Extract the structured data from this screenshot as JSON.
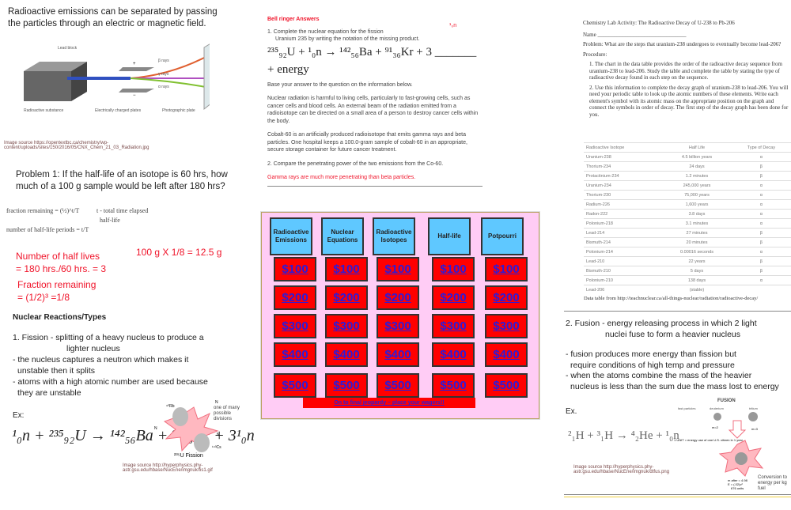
{
  "left": {
    "intro": [
      "Radioactive emissions can be separated by passing",
      "the particles through an electric or magnetic field."
    ],
    "diagram_labels": {
      "lead_block": "Lead block",
      "beta": "β rays",
      "gamma": "γ rays",
      "alpha": "α rays",
      "substance": "Radioactive substance",
      "plates": "Electrically charged plates",
      "plate": "Photographic plate",
      "plus": "+",
      "minus": "−"
    },
    "image_source_1": [
      "Image source https://opentextbc.ca/chemistry/wp-",
      "content/uploads/sites/150/2016/05/CNX_Chem_21_03_Radiation.jpg"
    ],
    "problem": [
      "Problem 1: If the half-life of an isotope is 60 hrs, how",
      "much of a 100 g sample would be left after 180 hrs?"
    ],
    "formula": {
      "fraction": "fraction remaining = (½)^t/T",
      "periods": "number of half-life periods = t/T",
      "t_def": "t - total time elapsed",
      "T_def": "half-life"
    },
    "answer": {
      "halves_1": "Number of half lives",
      "halves_2": "= 180 hrs./60 hrs. = 3",
      "frac_1": "Fraction remaining",
      "frac_2": "= (1/2)³ =1/8",
      "result": "100 g X 1/8 = 12.5 g"
    },
    "heading": "Nuclear Reactions/Types",
    "fission": [
      "1.  Fission - splitting of a heavy nucleus to produce a",
      "lighter nucleus",
      "- the nucleus captures a neutron which makes it",
      "unstable then it splits",
      "- atoms with a high atomic number are used because",
      "they are unstable"
    ],
    "ex": "Ex:",
    "equation": "¹₀n + ²³⁵₉₂U → ¹⁴²₅₆Ba + ⁹¹₃₆Kr + 3¹₀n",
    "fission_img": {
      "title": "²³⁵U Fission",
      "rb": "⁹⁰Rb",
      "cs": "¹⁴³Cs",
      "n": "N",
      "note": "one of many possible divisions"
    },
    "image_source_2": [
      "Image source http://hyperphysics.phy-",
      "astr.gsu.edu/hbase/NucEne/imgnuk/fis1.gif"
    ]
  },
  "middle": {
    "title": "Bell ringer Answers",
    "corner": "¹₀n",
    "q1": [
      "1.   Complete the nuclear equation for the fission",
      "Uranium 235 by writing the notation of the missing product."
    ],
    "equation": "²³⁵₉₂U + ¹₀n → ¹⁴²₅₆Ba + ⁹¹₃₆Kr + 3 _______ + energy",
    "base": "Base your answer to the question on the information below.",
    "p1": "Nuclear radiation is harmful to living cells, particularly to fast-growing cells, such as cancer cells and blood cells. An external beam of the radiation emitted from a radioisotope can be directed on a small area of a person to destroy cancer cells within the body.",
    "p2": "Cobalt-60 is an artificially produced radioisotope that emits gamma rays and beta particles. One hospital keeps a 100.0-gram sample of cobalt-60 in an appropriate, secure storage container for future cancer treatment.",
    "q2": "2.   Compare the penetrating power of the two emissions from the Co-60.",
    "answer": "Gamma rays are much more penetrating than beta particles."
  },
  "jeopardy": {
    "categories": [
      "Radioactive Emissions",
      "Nuclear Equations",
      "Radioactive Isotopes",
      "Half-life",
      "Potpourri"
    ],
    "values": [
      "$100",
      "$200",
      "$300",
      "$400",
      "$500"
    ],
    "final": "On to final jeopardy – place your wagers!!",
    "colors": {
      "background": "#ffccf5",
      "category": "#5fc8ff",
      "cell": "#ff0000",
      "link": "#2d1bd8"
    }
  },
  "right": {
    "title": "Chemistry Lab Activity: The Radioactive Decay of U-238 to Pb-206",
    "name": "Name ________________________________",
    "problem": "Problem: What are the steps that uranium-238 undergoes to eventually become lead-206?",
    "procedure": "Procedure:",
    "steps": [
      "1.  The chart in the data table provides the order of the radioactive decay sequence from uranium-238 to lead-206.   Study the table and complete the table by stating the type of radioactive decay found in each step on the sequence.",
      "2.  Use this information to complete the decay graph of uranium-238 to lead-206.  You will need your periodic table to look up the atomic numbers of these elements.  Write each element's symbol with its atomic mass on the appropriate position on the graph and connect the symbols in order of decay. The first step of the decay graph has been done for you."
    ],
    "table": {
      "headers": [
        "Radioactive Isotope",
        "Half Life",
        "Type of Decay"
      ],
      "rows": [
        [
          "Uranium-238",
          "4.5 billion years",
          "α"
        ],
        [
          "Thorium-234",
          "24 days",
          "β"
        ],
        [
          "Protactinium-234",
          "1.2 minutes",
          "β"
        ],
        [
          "Uranium-234",
          "245,000 years",
          "α"
        ],
        [
          "Thorium-230",
          "75,000 years",
          "α"
        ],
        [
          "Radium-226",
          "1,600 years",
          "α"
        ],
        [
          "Radon-222",
          "3.8 days",
          "α"
        ],
        [
          "Polonium-218",
          "3.1 minutes",
          "α"
        ],
        [
          "Lead-214",
          "27 minutes",
          "β"
        ],
        [
          "Bismuth-214",
          "20 minutes",
          "β"
        ],
        [
          "Polonium-214",
          "0.00016 seconds",
          "α"
        ],
        [
          "Lead-210",
          "22 years",
          "β"
        ],
        [
          "Bismuth-210",
          "5 days",
          "β"
        ],
        [
          "Polonium-210",
          "138 days",
          "α"
        ],
        [
          "Lead-206",
          "(stable)",
          ""
        ]
      ]
    },
    "source": "Data table from http://teachnuclear.ca/all-things-nuclear/radiation/radioactive-decay/"
  },
  "fusion": {
    "lines": [
      "2. Fusion - energy releasing process in which 2 light",
      "nuclei fuse to form a heavier nucleus",
      "- fusion produces more energy than fission but",
      "require conditions  of high temp and pressure",
      "- when the atoms combine the mass of the heavier",
      "nucleus is less than the sum due the mass lost to energy"
    ],
    "ex": "Ex.",
    "equation": "²₁H + ³₁H → ⁴₂He + ¹₀n",
    "img": {
      "title": "FUSION",
      "fast": "fast particles",
      "deut": "deuterium",
      "trit": "tritium",
      "unit": "1 UNIT = energy use of one U.S. citizen in 1 year.",
      "m2": "m=2",
      "m3": "m=3",
      "mafter": "m after = 4.98",
      "e": "E = (.02)c²",
      "units": "676 units",
      "conv": "Conversion to energy per kg fuel"
    },
    "source": [
      "Image source http://hyperphysics.phy-",
      "astr.gsu.edu/hbase/NucEne/imgnuk/dtfus.png"
    ]
  }
}
